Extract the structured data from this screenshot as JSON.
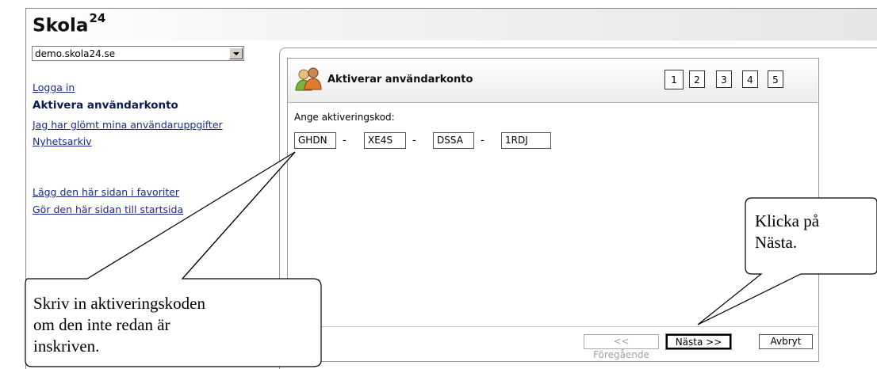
{
  "brand": {
    "name": "Skola",
    "sup": "24"
  },
  "domain_select": {
    "value": "demo.skola24.se"
  },
  "sidebar": {
    "items": [
      {
        "label": "Logga in"
      },
      {
        "label": "Aktivera användarkonto"
      },
      {
        "label": "Jag har glömt mina användaruppgifter"
      },
      {
        "label": "Nyhetsarkiv"
      },
      {
        "label": "Lägg den här sidan i favoriter"
      },
      {
        "label": "Gör den här sidan till startsida"
      }
    ]
  },
  "panel": {
    "title": "Aktiverar användarkonto",
    "steps": [
      "1",
      "2",
      "3",
      "4",
      "5"
    ],
    "code_label": "Ange aktiveringskod:",
    "code_parts": [
      "GHDN",
      "XE4S",
      "DSSA",
      "1RDJ"
    ],
    "separator": "-"
  },
  "buttons": {
    "previous": "<< Föregående",
    "next": "Nästa >>",
    "cancel": "Avbryt"
  },
  "callouts": {
    "next_hint": [
      "Klicka på",
      "Nästa."
    ],
    "code_hint": [
      "Skriv in aktiveringskoden",
      "om den inte redan är",
      "inskriven."
    ]
  }
}
